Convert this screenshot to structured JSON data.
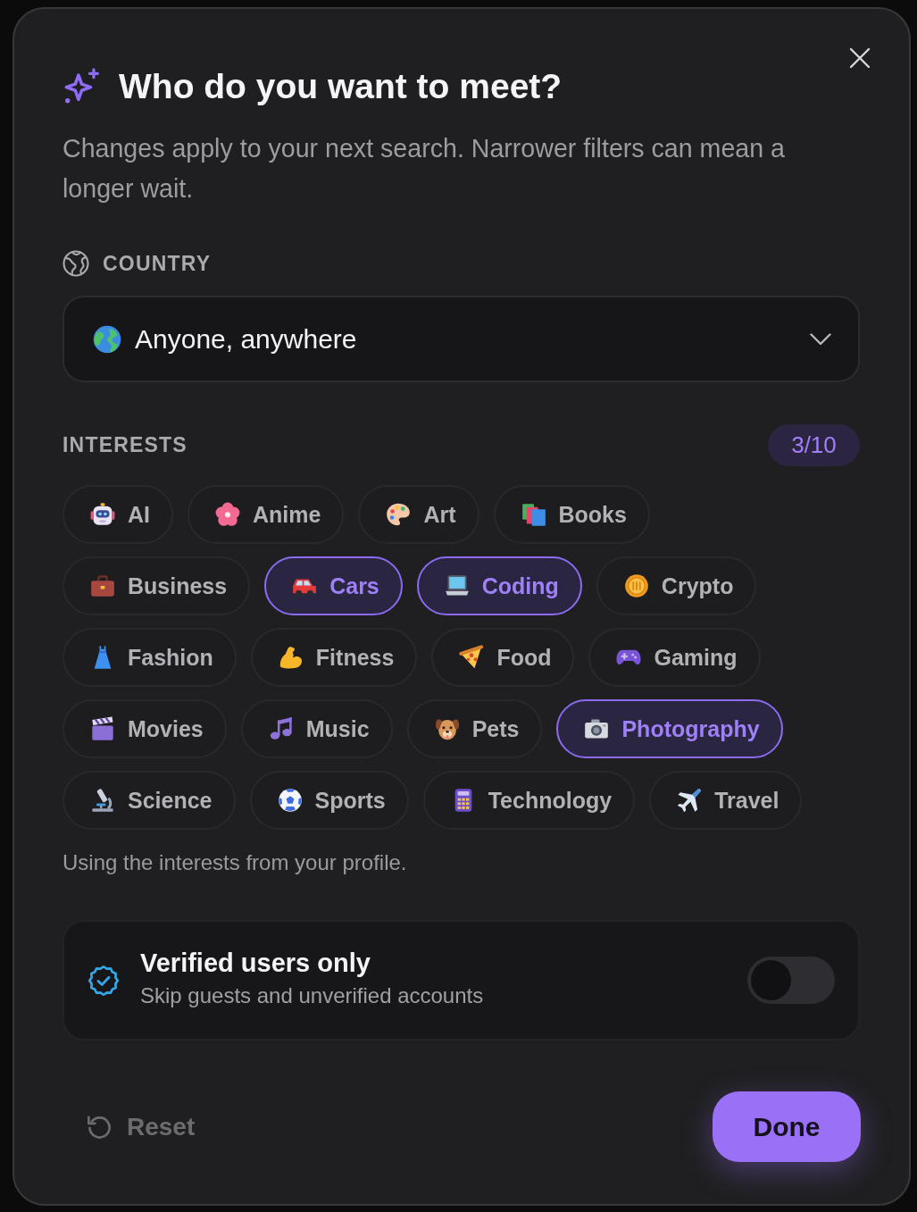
{
  "dialog": {
    "title": "Who do you want to meet?",
    "subtitle": "Changes apply to your next search. Narrower filters can mean a longer wait."
  },
  "country": {
    "label": "COUNTRY",
    "value": "Anyone, anywhere"
  },
  "interests": {
    "label": "INTERESTS",
    "count": "3/10",
    "rows": [
      [
        {
          "label": "AI",
          "selected": false
        },
        {
          "label": "Anime",
          "selected": false
        },
        {
          "label": "Art",
          "selected": false
        },
        {
          "label": "Books",
          "selected": false
        }
      ],
      [
        {
          "label": "Business",
          "selected": false
        },
        {
          "label": "Cars",
          "selected": true
        },
        {
          "label": "Coding",
          "selected": true
        },
        {
          "label": "Crypto",
          "selected": false
        }
      ],
      [
        {
          "label": "Fashion",
          "selected": false
        },
        {
          "label": "Fitness",
          "selected": false
        },
        {
          "label": "Food",
          "selected": false
        },
        {
          "label": "Gaming",
          "selected": false
        }
      ],
      [
        {
          "label": "Movies",
          "selected": false
        },
        {
          "label": "Music",
          "selected": false
        },
        {
          "label": "Pets",
          "selected": false
        },
        {
          "label": "Photography",
          "selected": true
        }
      ],
      [
        {
          "label": "Science",
          "selected": false
        },
        {
          "label": "Sports",
          "selected": false
        },
        {
          "label": "Technology",
          "selected": false
        },
        {
          "label": "Travel",
          "selected": false
        }
      ]
    ],
    "note": "Using the interests from your profile."
  },
  "verified": {
    "title": "Verified users only",
    "subtitle": "Skip guests and unverified accounts",
    "on": false
  },
  "footer": {
    "reset": "Reset",
    "done": "Done"
  }
}
